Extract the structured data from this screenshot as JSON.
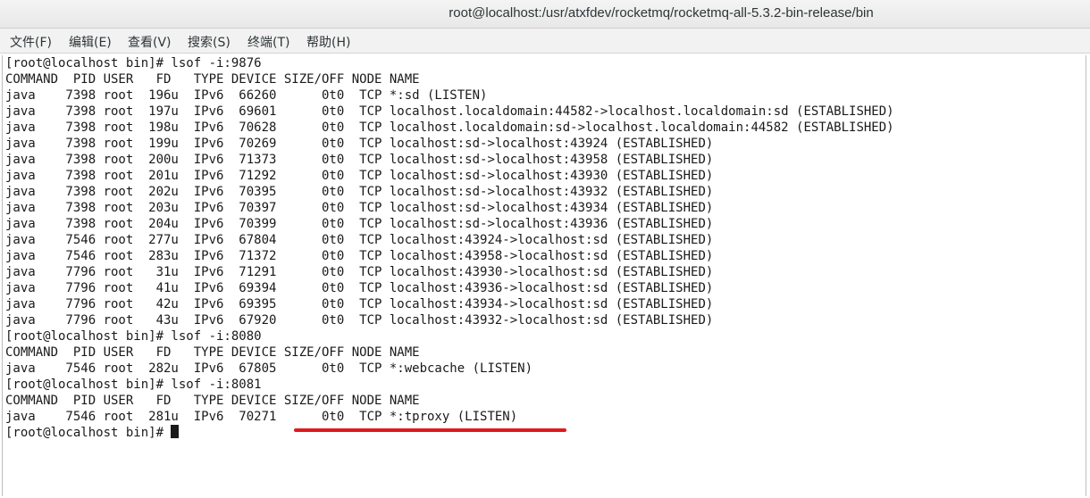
{
  "window": {
    "title": "root@localhost:/usr/atxfdev/rocketmq/rocketmq-all-5.3.2-bin-release/bin"
  },
  "menu": [
    "文件(F)",
    "编辑(E)",
    "查看(V)",
    "搜索(S)",
    "终端(T)",
    "帮助(H)"
  ],
  "terminal": {
    "lines": [
      "[root@localhost bin]# lsof -i:9876",
      "COMMAND  PID USER   FD   TYPE DEVICE SIZE/OFF NODE NAME",
      "java    7398 root  196u  IPv6  66260      0t0  TCP *:sd (LISTEN)",
      "java    7398 root  197u  IPv6  69601      0t0  TCP localhost.localdomain:44582->localhost.localdomain:sd (ESTABLISHED)",
      "java    7398 root  198u  IPv6  70628      0t0  TCP localhost.localdomain:sd->localhost.localdomain:44582 (ESTABLISHED)",
      "java    7398 root  199u  IPv6  70269      0t0  TCP localhost:sd->localhost:43924 (ESTABLISHED)",
      "java    7398 root  200u  IPv6  71373      0t0  TCP localhost:sd->localhost:43958 (ESTABLISHED)",
      "java    7398 root  201u  IPv6  71292      0t0  TCP localhost:sd->localhost:43930 (ESTABLISHED)",
      "java    7398 root  202u  IPv6  70395      0t0  TCP localhost:sd->localhost:43932 (ESTABLISHED)",
      "java    7398 root  203u  IPv6  70397      0t0  TCP localhost:sd->localhost:43934 (ESTABLISHED)",
      "java    7398 root  204u  IPv6  70399      0t0  TCP localhost:sd->localhost:43936 (ESTABLISHED)",
      "java    7546 root  277u  IPv6  67804      0t0  TCP localhost:43924->localhost:sd (ESTABLISHED)",
      "java    7546 root  283u  IPv6  71372      0t0  TCP localhost:43958->localhost:sd (ESTABLISHED)",
      "java    7796 root   31u  IPv6  71291      0t0  TCP localhost:43930->localhost:sd (ESTABLISHED)",
      "java    7796 root   41u  IPv6  69394      0t0  TCP localhost:43936->localhost:sd (ESTABLISHED)",
      "java    7796 root   42u  IPv6  69395      0t0  TCP localhost:43934->localhost:sd (ESTABLISHED)",
      "java    7796 root   43u  IPv6  67920      0t0  TCP localhost:43932->localhost:sd (ESTABLISHED)",
      "[root@localhost bin]# lsof -i:8080",
      "COMMAND  PID USER   FD   TYPE DEVICE SIZE/OFF NODE NAME",
      "java    7546 root  282u  IPv6  67805      0t0  TCP *:webcache (LISTEN)",
      "[root@localhost bin]# lsof -i:8081",
      "COMMAND  PID USER   FD   TYPE DEVICE SIZE/OFF NODE NAME",
      "java    7546 root  281u  IPv6  70271      0t0  TCP *:tproxy (LISTEN)"
    ],
    "prompt": "[root@localhost bin]# "
  },
  "colors": {
    "annotation": "#e0191e",
    "text": "#1a1a1a"
  }
}
